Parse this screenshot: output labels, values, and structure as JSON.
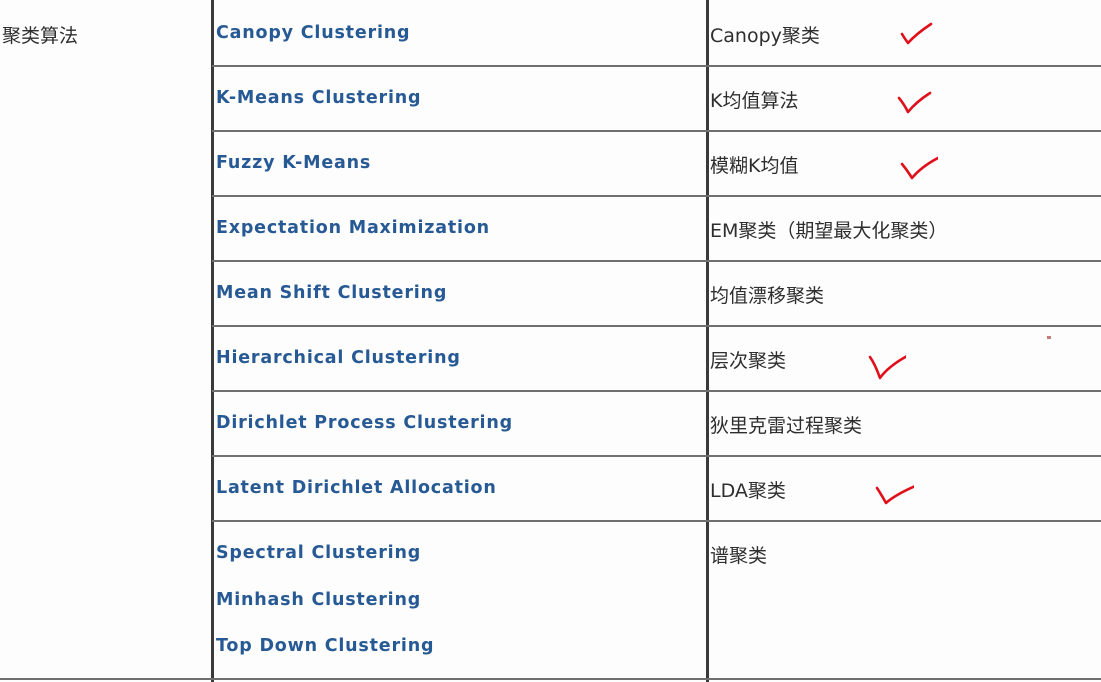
{
  "category": "聚类算法",
  "rows": [
    {
      "en": [
        "Canopy Clustering"
      ],
      "cn": "Canopy聚类",
      "check": true
    },
    {
      "en": [
        "K-Means Clustering"
      ],
      "cn": "K均值算法",
      "check": true
    },
    {
      "en": [
        "Fuzzy K-Means"
      ],
      "cn": "模糊K均值",
      "check": true
    },
    {
      "en": [
        "Expectation Maximization"
      ],
      "cn": "EM聚类（期望最大化聚类）",
      "check": false
    },
    {
      "en": [
        "Mean Shift Clustering"
      ],
      "cn": "均值漂移聚类",
      "check": false
    },
    {
      "en": [
        "Hierarchical Clustering"
      ],
      "cn": "层次聚类",
      "check": true
    },
    {
      "en": [
        "Dirichlet Process Clustering"
      ],
      "cn": "狄里克雷过程聚类",
      "check": false
    },
    {
      "en": [
        "Latent Dirichlet Allocation"
      ],
      "cn": "LDA聚类",
      "check": true
    },
    {
      "en": [
        "Spectral Clustering",
        "Minhash Clustering",
        "Top Down Clustering"
      ],
      "cn": "谱聚类",
      "check": false
    }
  ]
}
